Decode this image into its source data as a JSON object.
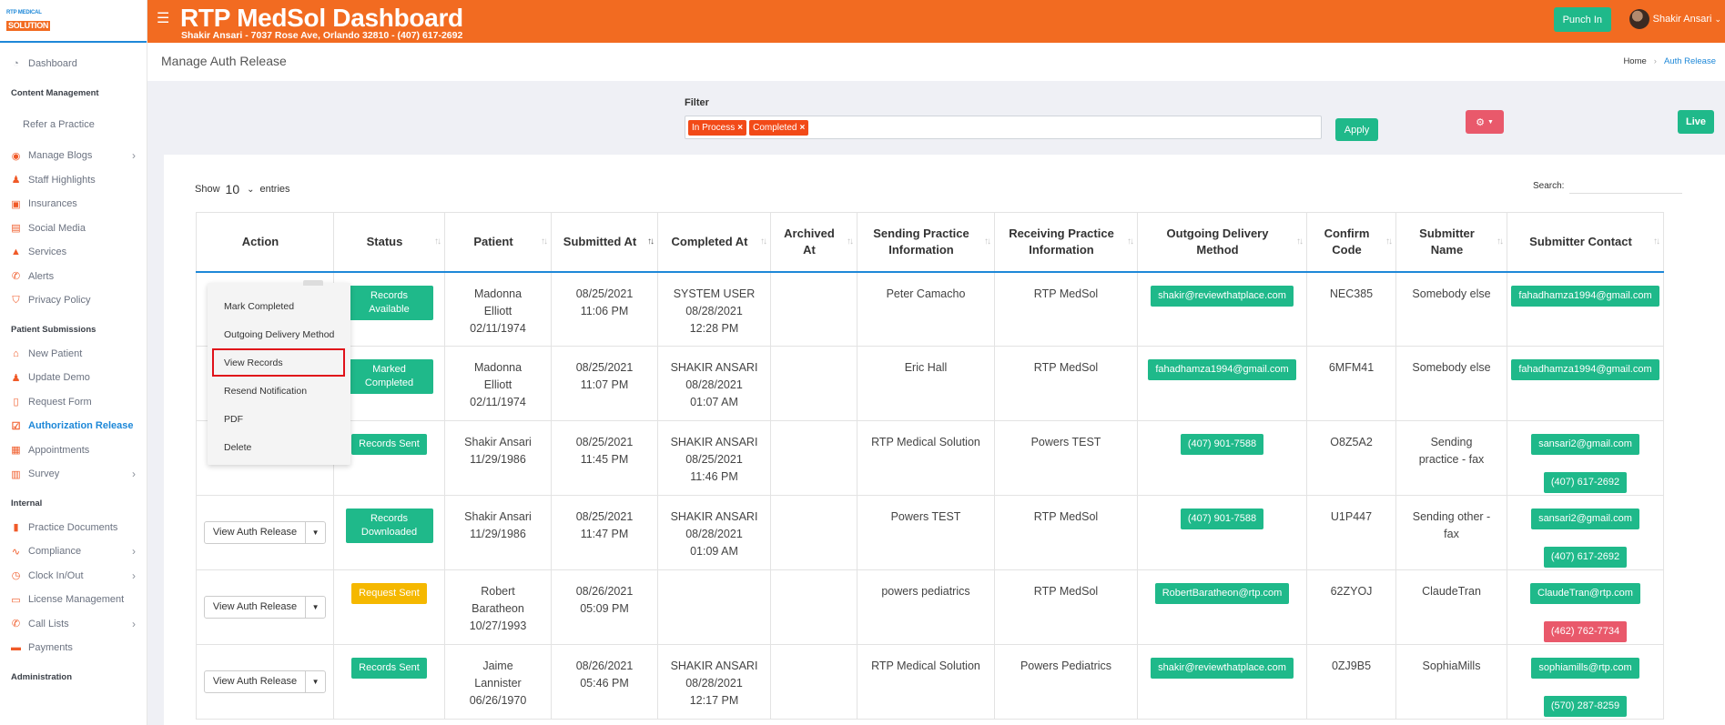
{
  "logo": {
    "line1": "RTP MEDICAL",
    "line2": "SOLUTION"
  },
  "topbar": {
    "title": "RTP MedSol Dashboard",
    "subtitle": "Shakir Ansari - 7037 Rose Ave, Orlando 32810 - (407) 617-2692",
    "punch_label": "Punch In",
    "user_name": "Shakir Ansari"
  },
  "header": {
    "page_title": "Manage Auth Release",
    "breadcrumb_home": "Home",
    "breadcrumb_current": "Auth Release"
  },
  "sidebar": {
    "dashboard": "Dashboard",
    "content_management": "Content Management",
    "refer": "Refer a Practice",
    "manage_blogs": "Manage Blogs",
    "staff_highlights": "Staff Highlights",
    "insurances": "Insurances",
    "social_media": "Social Media",
    "services": "Services",
    "alerts": "Alerts",
    "privacy_policy": "Privacy Policy",
    "patient_submissions": "Patient Submissions",
    "new_patient": "New Patient",
    "update_demo": "Update Demo",
    "request_form": "Request Form",
    "authorization_release": "Authorization Release",
    "appointments": "Appointments",
    "survey": "Survey",
    "internal": "Internal",
    "practice_documents": "Practice Documents",
    "compliance": "Compliance",
    "clock": "Clock In/Out",
    "license": "License Management",
    "call_lists": "Call Lists",
    "payments": "Payments",
    "administration": "Administration"
  },
  "filter": {
    "label": "Filter",
    "chips": [
      "In Process",
      "Completed"
    ],
    "apply": "Apply",
    "live": "Live"
  },
  "table_controls": {
    "show": "Show",
    "entries_value": "10",
    "entries": "entries",
    "search": "Search:"
  },
  "columns": {
    "action": "Action",
    "status": "Status",
    "patient": "Patient",
    "submitted_at": "Submitted At",
    "completed_at": "Completed At",
    "archived_at_1": "Archived",
    "archived_at_2": "At",
    "sending_1": "Sending Practice",
    "sending_2": "Information",
    "receiving_1": "Receiving Practice",
    "receiving_2": "Information",
    "outgoing_1": "Outgoing Delivery",
    "outgoing_2": "Method",
    "confirm_1": "Confirm",
    "confirm_2": "Code",
    "submitter_1": "Submitter",
    "submitter_2": "Name",
    "contact": "Submitter Contact"
  },
  "action_button": "View Auth Release",
  "dropdown": {
    "items": [
      "Mark Completed",
      "Outgoing Delivery Method",
      "View Records",
      "Resend Notification",
      "PDF",
      "Delete"
    ]
  },
  "rows": [
    {
      "status": "Records Available",
      "status_color": "green",
      "patient": [
        "Madonna",
        "Elliott",
        "02/11/1974"
      ],
      "submitted": [
        "08/25/2021",
        "11:06 PM"
      ],
      "completed": [
        "SYSTEM USER",
        "08/28/2021",
        "12:28 PM"
      ],
      "sending": "Peter Camacho",
      "receiving": "RTP MedSol",
      "outgoing": "shakir@reviewthatplace.com",
      "code": "NEC385",
      "submitter": [
        "Somebody else"
      ],
      "contacts": [
        {
          "text": "fahadhamza1994@gmail.com",
          "color": "green"
        }
      ]
    },
    {
      "status": "Marked Completed",
      "status_color": "green",
      "patient": [
        "Madonna",
        "Elliott",
        "02/11/1974"
      ],
      "submitted": [
        "08/25/2021",
        "11:07 PM"
      ],
      "completed": [
        "SHAKIR ANSARI",
        "08/28/2021",
        "01:07 AM"
      ],
      "sending": "Eric Hall",
      "receiving": "RTP MedSol",
      "outgoing": "fahadhamza1994@gmail.com",
      "code": "6MFM41",
      "submitter": [
        "Somebody else"
      ],
      "contacts": [
        {
          "text": "fahadhamza1994@gmail.com",
          "color": "green"
        }
      ]
    },
    {
      "status": "Records Sent",
      "status_color": "green",
      "patient": [
        "Shakir Ansari",
        "11/29/1986"
      ],
      "submitted": [
        "08/25/2021",
        "11:45 PM"
      ],
      "completed": [
        "SHAKIR ANSARI",
        "08/25/2021",
        "11:46 PM"
      ],
      "sending": "RTP Medical Solution",
      "receiving": "Powers TEST",
      "outgoing": "(407) 901-7588",
      "code": "O8Z5A2",
      "submitter": [
        "Sending",
        "practice - fax"
      ],
      "contacts": [
        {
          "text": "sansari2@gmail.com",
          "color": "green"
        },
        {
          "text": "(407) 617-2692",
          "color": "green"
        }
      ]
    },
    {
      "status": "Records Downloaded",
      "status_color": "green",
      "patient": [
        "Shakir Ansari",
        "11/29/1986"
      ],
      "submitted": [
        "08/25/2021",
        "11:47 PM"
      ],
      "completed": [
        "SHAKIR ANSARI",
        "08/28/2021",
        "01:09 AM"
      ],
      "sending": "Powers TEST",
      "receiving": "RTP MedSol",
      "outgoing": "(407) 901-7588",
      "code": "U1P447",
      "submitter": [
        "Sending other -",
        "fax"
      ],
      "contacts": [
        {
          "text": "sansari2@gmail.com",
          "color": "green"
        },
        {
          "text": "(407) 617-2692",
          "color": "green"
        }
      ]
    },
    {
      "status": "Request Sent",
      "status_color": "yellow",
      "patient": [
        "Robert",
        "Baratheon",
        "10/27/1993"
      ],
      "submitted": [
        "08/26/2021",
        "05:09 PM"
      ],
      "completed": [],
      "sending": "powers pediatrics",
      "receiving": "RTP MedSol",
      "outgoing": "RobertBaratheon@rtp.com",
      "code": "62ZYOJ",
      "submitter": [
        "ClaudeTran"
      ],
      "contacts": [
        {
          "text": "ClaudeTran@rtp.com",
          "color": "green"
        },
        {
          "text": "(462) 762-7734",
          "color": "red"
        }
      ]
    },
    {
      "status": "Records Sent",
      "status_color": "green",
      "patient": [
        "Jaime",
        "Lannister",
        "06/26/1970"
      ],
      "submitted": [
        "08/26/2021",
        "05:46 PM"
      ],
      "completed": [
        "SHAKIR ANSARI",
        "08/28/2021",
        "12:17 PM"
      ],
      "sending": "RTP Medical Solution",
      "receiving": "Powers Pediatrics",
      "outgoing": "shakir@reviewthatplace.com",
      "code": "0ZJ9B5",
      "submitter": [
        "SophiaMills"
      ],
      "contacts": [
        {
          "text": "sophiamills@rtp.com",
          "color": "green"
        },
        {
          "text": "(570) 287-8259",
          "color": "green"
        }
      ]
    }
  ]
}
